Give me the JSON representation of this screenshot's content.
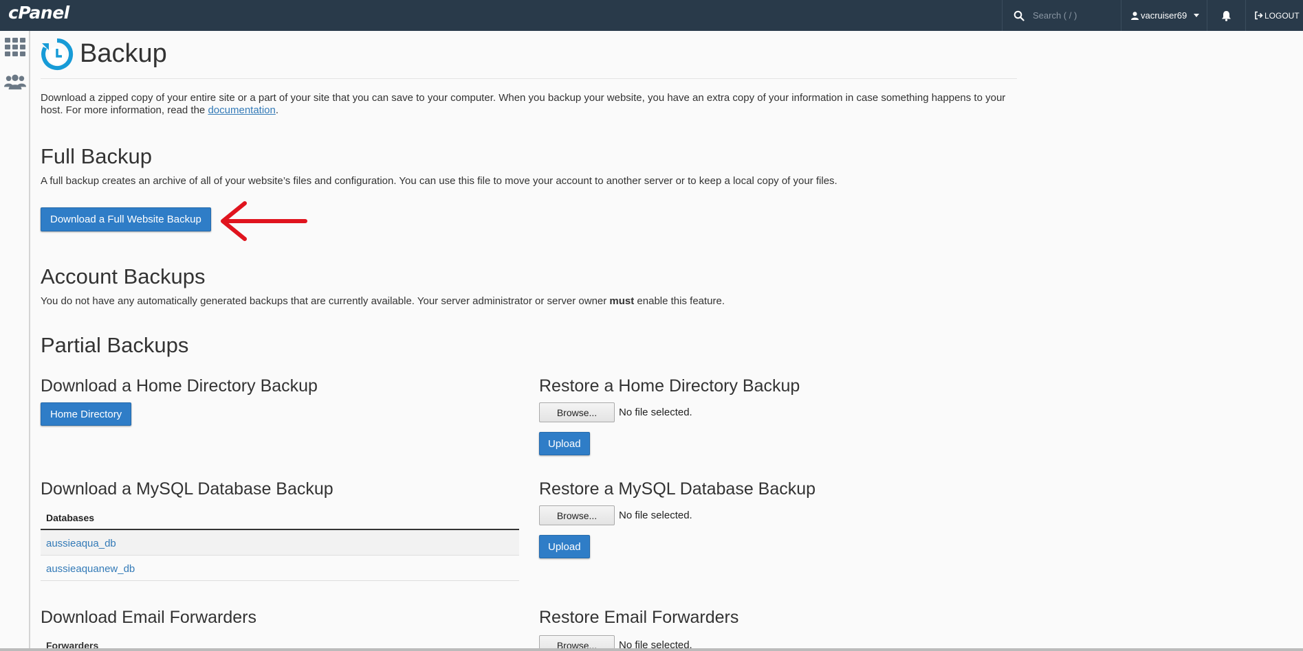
{
  "topbar": {
    "logo": "cPanel",
    "search_placeholder": "Search ( / )",
    "username": "vacruiser69",
    "logout_label": "LOGOUT"
  },
  "sidebar": {
    "icons": [
      "grid-icon",
      "users-icon"
    ]
  },
  "page": {
    "title": "Backup",
    "intro_text": "Download a zipped copy of your entire site or a part of your site that you can save to your computer. When you backup your website, you have an extra copy of your information in case something happens to your host. For more information, read the ",
    "intro_link": "documentation",
    "intro_end": "."
  },
  "full_backup": {
    "heading": "Full Backup",
    "description": "A full backup creates an archive of all of your website’s files and configuration. You can use this file to move your account to another server or to keep a local copy of your files.",
    "button": "Download a Full Website Backup"
  },
  "account_backups": {
    "heading": "Account Backups",
    "description_pre": "You do not have any automatically generated backups that are currently available. Your server administrator or server owner ",
    "description_bold": "must",
    "description_post": " enable this feature."
  },
  "partial_backups": {
    "heading": "Partial Backups",
    "home_download_heading": "Download a Home Directory Backup",
    "home_download_button": "Home Directory",
    "home_restore_heading": "Restore a Home Directory Backup",
    "mysql_download_heading": "Download a MySQL Database Backup",
    "databases_header": "Databases",
    "databases": [
      "aussieaqua_db",
      "aussieaquanew_db"
    ],
    "mysql_restore_heading": "Restore a MySQL Database Backup",
    "email_download_heading": "Download Email Forwarders",
    "forwarders_header": "Forwarders",
    "email_restore_heading": "Restore Email Forwarders",
    "browse_label": "Browse...",
    "no_file": "No file selected.",
    "upload_label": "Upload"
  },
  "colors": {
    "topbar": "#293a4a",
    "primary_button": "#2f7dc7",
    "annotation_arrow": "#e0141e"
  }
}
